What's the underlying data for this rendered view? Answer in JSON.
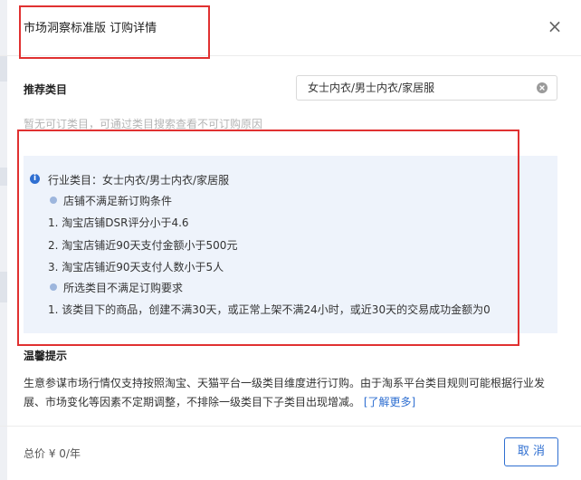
{
  "dialog": {
    "title": "市场洞察标准版 订购详情",
    "close_icon": "close-icon"
  },
  "form": {
    "label": "推荐类目",
    "category_value": "女士内衣/男士内衣/家居服",
    "clear_icon": "clear-circle-icon",
    "hint": "暂无可订类目，可通过类目搜索查看不可订购原因"
  },
  "info": {
    "icon": "info-circle-icon",
    "category_line": "行业类目：女士内衣/男士内衣/家居服",
    "store_header": "店铺不满足新订购条件",
    "store_items": [
      "1. 淘宝店铺DSR评分小于4.6",
      "2. 淘宝店铺近90天支付金额小于500元",
      "3. 淘宝店铺近90天支付人数小于5人"
    ],
    "category_header": "所选类目不满足订购要求",
    "category_items": [
      "1. 该类目下的商品，创建不满30天，或正常上架不满24小时，或近30天的交易成功金额为0"
    ]
  },
  "tips": {
    "title": "温馨提示",
    "body": "生意参谋市场行情仅支持按照淘宝、天猫平台一级类目维度进行订购。由于淘系平台类目规则可能根据行业发展、市场变化等因素不定期调整，不排除一级类目下子类目出现增减。",
    "link": "[了解更多]"
  },
  "footer": {
    "total": "总价 ¥ 0/年",
    "cancel_label": "取 消"
  },
  "colors": {
    "accent": "#2f6fd1",
    "annotation": "#e03131",
    "panel_bg": "#eef3fb"
  }
}
